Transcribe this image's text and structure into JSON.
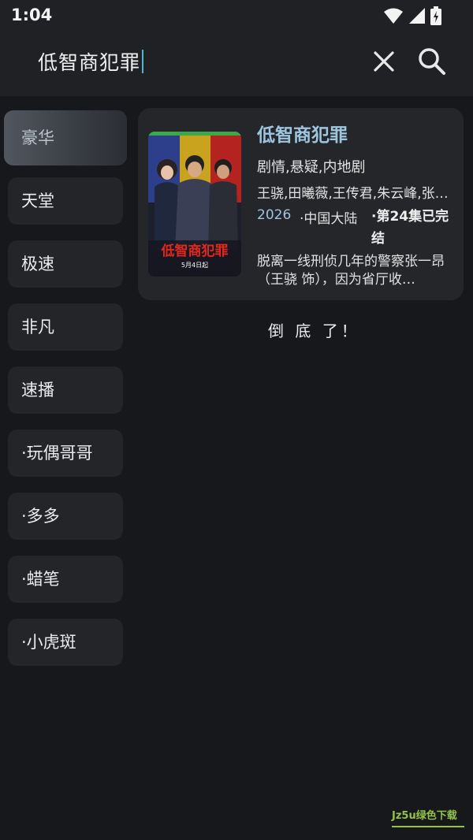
{
  "status": {
    "time": "1:04"
  },
  "search": {
    "query": "低智商犯罪"
  },
  "sidebar": {
    "items": [
      {
        "label": "豪华",
        "active": true
      },
      {
        "label": "天堂"
      },
      {
        "label": "极速"
      },
      {
        "label": "非凡"
      },
      {
        "label": "速播"
      },
      {
        "label": "·玩偶哥哥"
      },
      {
        "label": "·多多"
      },
      {
        "label": "·蜡笔"
      },
      {
        "label": "·小虎斑"
      }
    ]
  },
  "result": {
    "title": "低智商犯罪",
    "genre": "剧情,悬疑,内地剧",
    "cast": "王骁,田曦薇,王传君,朱云峰,张…",
    "year": "2026",
    "region": "·中国大陆",
    "episodes": "·第24集已完结",
    "description": "脱离一线刑侦几年的警察张一昂（王骁 饰），因为省厅收…",
    "poster": {
      "title_art": "低智商犯罪",
      "date_text": "5月4日起"
    }
  },
  "list": {
    "end_text": "倒 底 了！"
  },
  "watermark": {
    "text": "Jz5u绿色下载"
  },
  "colors": {
    "accent": "#9ec6df",
    "background": "#17181c",
    "card": "#25262a",
    "caret": "#4fb6c9"
  }
}
